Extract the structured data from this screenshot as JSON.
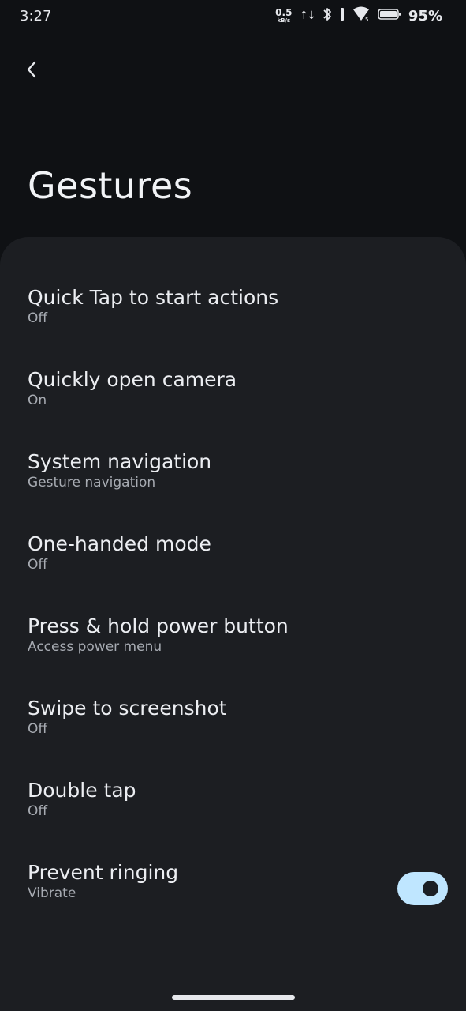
{
  "status_bar": {
    "time": "3:27",
    "net_speed_value": "0.5",
    "net_speed_unit": "kB/s",
    "battery_percent": "95%"
  },
  "header": {
    "back_icon": "chevron-left-icon",
    "title": "Gestures"
  },
  "settings": [
    {
      "title": "Quick Tap to start actions",
      "summary": "Off"
    },
    {
      "title": "Quickly open camera",
      "summary": "On"
    },
    {
      "title": "System navigation",
      "summary": "Gesture navigation"
    },
    {
      "title": "One-handed mode",
      "summary": "Off"
    },
    {
      "title": "Press & hold power button",
      "summary": "Access power menu"
    },
    {
      "title": "Swipe to screenshot",
      "summary": "Off"
    },
    {
      "title": "Double tap",
      "summary": "Off"
    },
    {
      "title": "Prevent ringing",
      "summary": "Vibrate",
      "toggle_on": true
    }
  ],
  "colors": {
    "background": "#0f1114",
    "sheet": "#1c1e22",
    "toggle_track_on": "#bfe6ff"
  }
}
